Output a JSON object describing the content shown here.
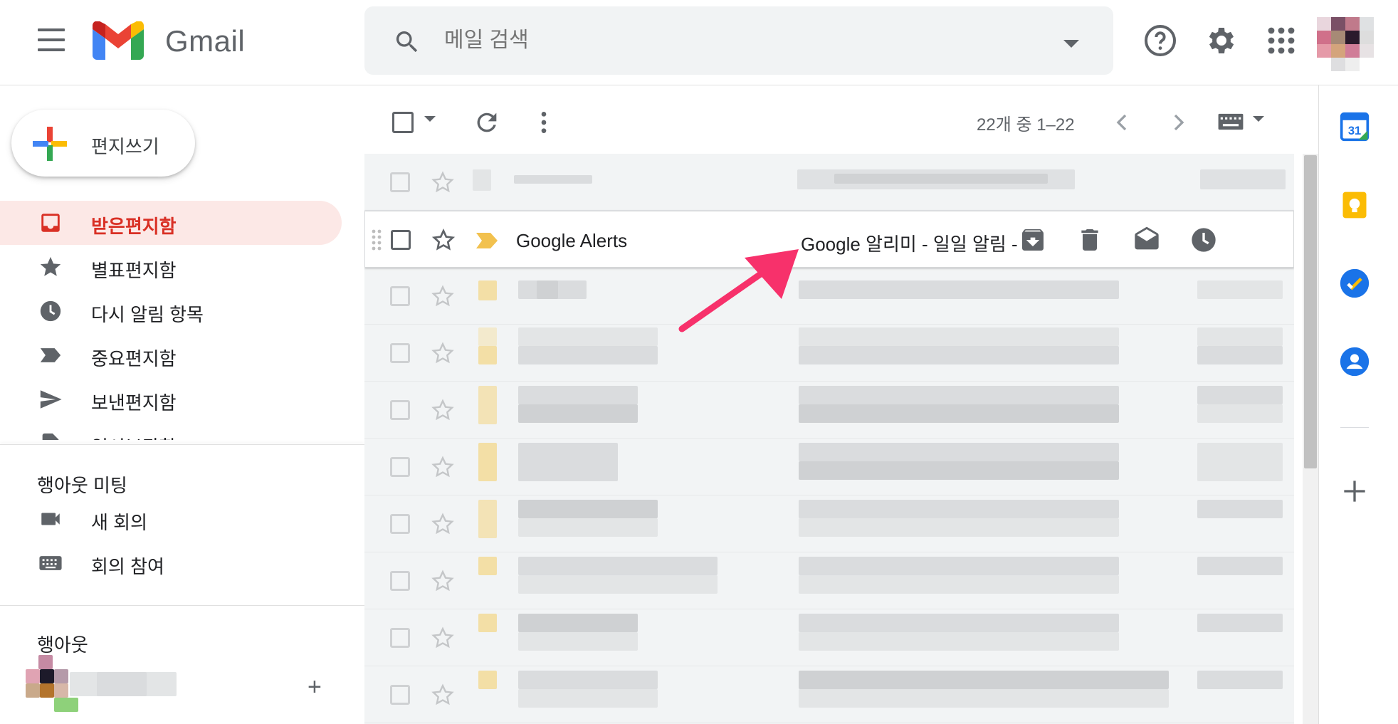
{
  "header": {
    "brand": "Gmail",
    "search_placeholder": "메일 검색"
  },
  "compose_label": "편지쓰기",
  "nav": [
    {
      "label": "받은편지함",
      "icon": "inbox-icon",
      "active": true
    },
    {
      "label": "별표편지함",
      "icon": "star-icon"
    },
    {
      "label": "다시 알림 항목",
      "icon": "clock-icon"
    },
    {
      "label": "중요편지함",
      "icon": "label-important-icon"
    },
    {
      "label": "보낸편지함",
      "icon": "send-icon"
    },
    {
      "label": "임시보관함",
      "icon": "draft-icon"
    }
  ],
  "meet": {
    "title": "행아웃 미팅",
    "items": [
      {
        "label": "새 회의",
        "icon": "video-camera-icon"
      },
      {
        "label": "회의 참여",
        "icon": "keyboard-icon"
      }
    ]
  },
  "hangouts": {
    "title": "행아웃",
    "add_label": "+"
  },
  "toolbar": {
    "count": "22개 중 1–22"
  },
  "emails": [
    {
      "sender": "Google Alerts",
      "subject": "Google 알리미 - 일일 알림 - ..."
    }
  ],
  "colors": {
    "active_nav_bg": "#fce8e6",
    "active_nav_text": "#d93025",
    "important_marker": "#f2c14e",
    "arrow": "#f7316b"
  }
}
